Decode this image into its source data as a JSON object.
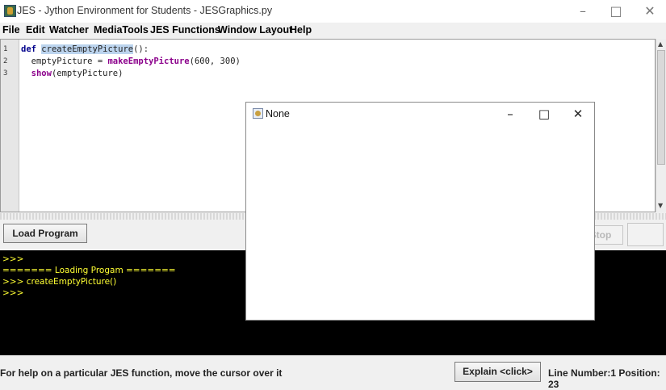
{
  "window": {
    "title": "JES - Jython Environment for Students - JESGraphics.py",
    "app_icon": "jes-app-icon",
    "controls": {
      "minimize": "–",
      "maximize": "□",
      "close": "✕"
    }
  },
  "menu": {
    "items": [
      "File",
      "Edit",
      "Watcher",
      "MediaTools",
      "JES Functions",
      "Window Layout",
      "Help"
    ]
  },
  "editor": {
    "line_numbers": [
      "1",
      "2",
      "3"
    ],
    "line1": {
      "kw": "def",
      "selected": "createEmptyPicture",
      "rest": "():"
    },
    "line2": {
      "pre": "  emptyPicture = ",
      "fn": "makeEmptyPicture",
      "post": "(600, 300)"
    },
    "line3": {
      "pre": "  ",
      "fn": "show",
      "post": "(emptyPicture)"
    }
  },
  "command_bar": {
    "load_button": "Load Program",
    "stop_button": "Stop"
  },
  "console": {
    "lines": [
      ">>>",
      "======= Loading Progam =======",
      ">>> createEmptyPicture()",
      ">>>"
    ]
  },
  "status": {
    "help_text": "For help on a particular JES function, move the cursor over it",
    "explain_button": "Explain <click>",
    "line_info": "Line Number:1 Position: 23"
  },
  "picture_window": {
    "title": "None",
    "controls": {
      "minimize": "–",
      "maximize": "□",
      "close": "✕"
    }
  },
  "colors": {
    "console_bg": "#000000",
    "console_text": "#ffff33",
    "keyword": "#00008b",
    "function": "#8b008b",
    "selection": "#bcd4ee"
  }
}
